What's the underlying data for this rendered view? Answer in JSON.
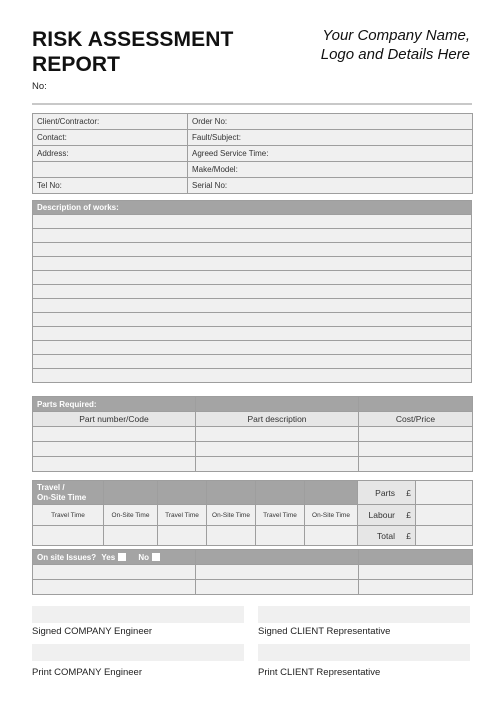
{
  "header": {
    "title_line1": "RISK ASSESSMENT",
    "title_line2": "REPORT",
    "no_label": "No:",
    "company_line1": "Your Company Name,",
    "company_line2": "Logo and Details Here"
  },
  "client": {
    "rows": [
      {
        "left": "Client/Contractor:",
        "right": "Order No:"
      },
      {
        "left": "Contact:",
        "right": "Fault/Subject:"
      },
      {
        "left": "Address:",
        "right": "Agreed Service Time:"
      },
      {
        "left": "",
        "right": "Make/Model:"
      },
      {
        "left": "Tel No:",
        "right": "Serial No:"
      }
    ]
  },
  "description": {
    "header": "Description of works:",
    "blank_rows": 12
  },
  "parts": {
    "header": "Parts Required:",
    "columns": [
      "Part number/Code",
      "Part description",
      "Cost/Price"
    ],
    "blank_rows": 3
  },
  "travel": {
    "header_line1": "Travel /",
    "header_line2": "On-Site Time",
    "columns": [
      "Travel Time",
      "On-Site Time",
      "Travel Time",
      "On-Site Time",
      "Travel Time",
      "On-Site Time"
    ],
    "cost_labels": [
      "Parts",
      "Labour",
      "Total"
    ],
    "currency_symbol": "£"
  },
  "issues": {
    "label": "On site Issues?",
    "yes_label": "Yes",
    "no_label": "No",
    "blank_rows": 2
  },
  "signatures": {
    "signed_company": "Signed COMPANY Engineer",
    "signed_client": "Signed CLIENT Representative",
    "print_company": "Print COMPANY Engineer",
    "print_client": "Print CLIENT Representative"
  }
}
